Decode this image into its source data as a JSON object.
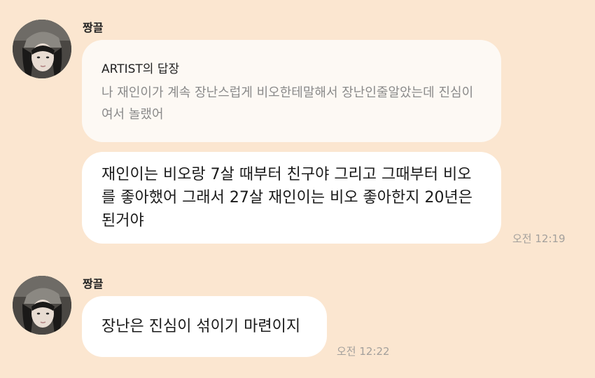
{
  "thread": {
    "group1": {
      "sender": "짱끌",
      "reply": {
        "title": "ARTIST의 답장",
        "text": "나 재인이가 계속 장난스럽게 비오한테말해서 장난인줄알았는데 진심이여서 놀랬어"
      },
      "message": {
        "text": "재인이는 비오랑 7살 때부터 친구야 그리고 그때부터 비오를 좋아했어 그래서 27살 재인이는 비오 좋아한지 20년은 된거야",
        "time": "오전 12:19"
      }
    },
    "group2": {
      "sender": "짱끌",
      "message": {
        "text": "장난은 진심이 섞이기 마련이지",
        "time": "오전 12:22"
      }
    }
  },
  "colors": {
    "background": "#fbe6d0",
    "bubble": "#ffffff",
    "reply_bubble": "#fdf9f4",
    "timestamp": "#a3a09c"
  },
  "icons": {
    "avatar": "profile-photo"
  }
}
